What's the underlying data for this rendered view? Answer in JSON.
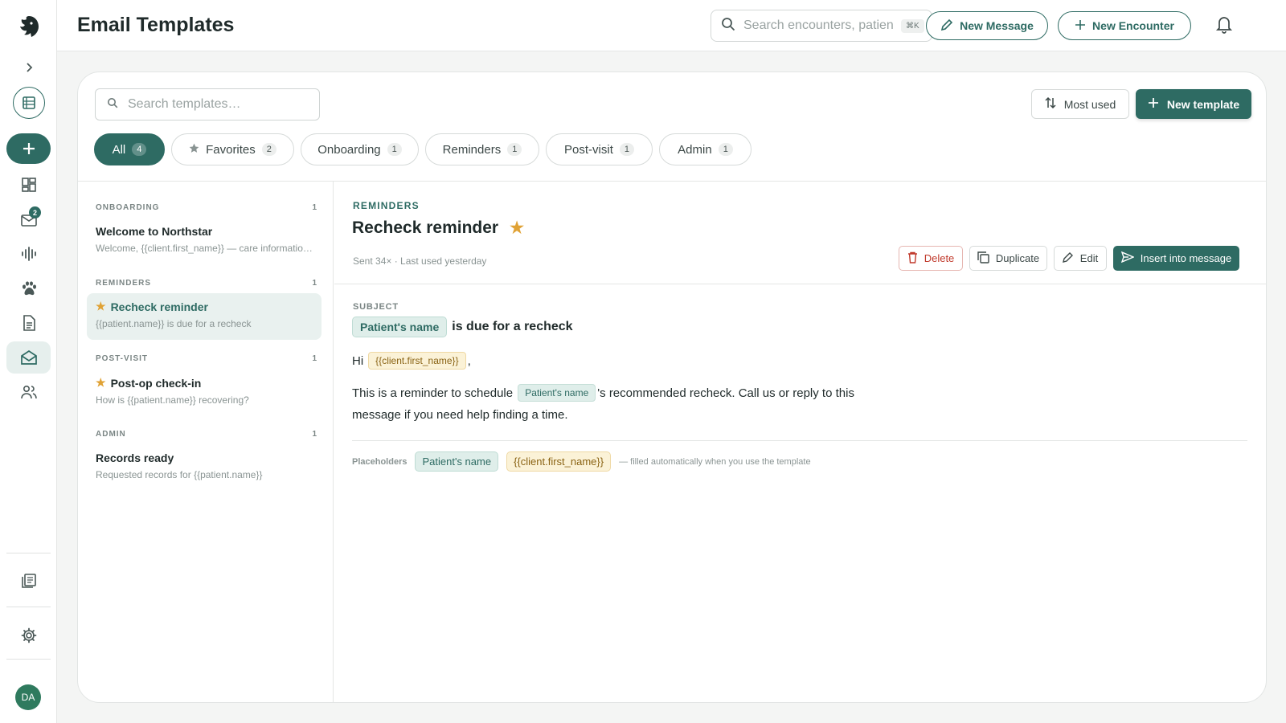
{
  "header": {
    "title": "Email Templates",
    "search_placeholder": "Search encounters, patients…",
    "search_shortcut": "⌘K",
    "new_message_label": "New Message",
    "new_encounter_label": "New Encounter"
  },
  "sidebar": {
    "inbox_badge": "2",
    "avatar_initials": "DA"
  },
  "templates_panel": {
    "search_placeholder": "Search templates…",
    "sort_label": "Most used",
    "new_template_label": "New template",
    "filters": [
      {
        "label": "All",
        "count": "4"
      },
      {
        "label": "Favorites",
        "count": "2"
      },
      {
        "label": "Onboarding",
        "count": "1"
      },
      {
        "label": "Reminders",
        "count": "1"
      },
      {
        "label": "Post-visit",
        "count": "1"
      },
      {
        "label": "Admin",
        "count": "1"
      }
    ],
    "groups": [
      {
        "name": "ONBOARDING",
        "count": "1",
        "items": [
          {
            "name": "Welcome to Northstar",
            "preview": "Welcome, {{client.first_name}} — care information for your visit"
          }
        ]
      },
      {
        "name": "REMINDERS",
        "count": "1",
        "items": [
          {
            "name": "Recheck reminder",
            "preview": "{{patient.name}} is due for a recheck"
          }
        ]
      },
      {
        "name": "POST-VISIT",
        "count": "1",
        "items": [
          {
            "name": "Post-op check-in",
            "preview": "How is {{patient.name}} recovering?"
          }
        ]
      },
      {
        "name": "ADMIN",
        "count": "1",
        "items": [
          {
            "name": "Records ready",
            "preview": "Requested records for {{patient.name}}"
          }
        ]
      }
    ]
  },
  "detail": {
    "category": "REMINDERS",
    "title": "Recheck reminder",
    "meta": "Sent 34× · Last used yesterday",
    "delete_label": "Delete",
    "duplicate_label": "Duplicate",
    "edit_label": "Edit",
    "insert_label": "Insert into message",
    "subject_label": "SUBJECT",
    "subject_placeholder": "Patient's name",
    "subject_text": "is due for a recheck",
    "greeting": "Hi",
    "client_token": "{{client.first_name}}",
    "greeting_comma": ",",
    "body_before": "This is a reminder to schedule",
    "patient_token": "Patient's name",
    "body_after": "'s recommended recheck. Call us or reply to this message if you need help finding a time.",
    "placeholders_label": "Placeholders",
    "placeholder_patient": "Patient's name",
    "placeholder_client": "{{client.first_name}}",
    "placeholders_note": "— filled automatically when you use the template"
  },
  "colors": {
    "accent": "#2e6b63",
    "favorite_star": "#e0a235"
  }
}
